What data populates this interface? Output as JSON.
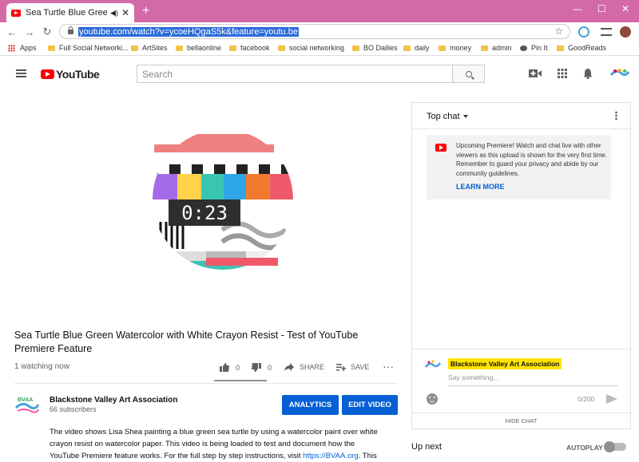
{
  "browser": {
    "tab_title": "Sea Turtle Blue Green Water",
    "url": "youtube.com/watch?v=ycoeHQgaS5k&feature=youtu.be",
    "bookmarks": [
      "Apps",
      "Full Social Networki...",
      "ArtSites",
      "bellaonline",
      "facebook",
      "social networking",
      "BO Dailies",
      "daily",
      "money",
      "admin",
      "Pin It",
      "GoodReads"
    ]
  },
  "youtube": {
    "logo_text": "YouTube",
    "search_placeholder": "Search"
  },
  "video": {
    "countdown": "0:23",
    "title": "Sea Turtle Blue Green Watercolor with White Crayon Resist - Test of YouTube Premiere Feature",
    "watching": "1 watching now",
    "likes": "0",
    "dislikes": "0",
    "share_label": "SHARE",
    "save_label": "SAVE"
  },
  "channel": {
    "name": "Blackstone Valley Art Association",
    "subscribers": "66 subscribers",
    "analytics_label": "ANALYTICS",
    "edit_label": "EDIT VIDEO"
  },
  "description": {
    "line1": "The video shows Lisa Shea painting a blue green sea turtle by using a watercolor paint over white",
    "line2": "crayon resist on watercolor paper. This video is being loaded to test and document how the",
    "line3_prefix": "YouTube Premiere feature works. For the full step by step instructions, visit ",
    "line3_link": "https://BVAA.org",
    "line3_suffix": ". This"
  },
  "chat": {
    "header": "Top chat",
    "premiere_text": "Upcoming Premiere! Watch and chat live with other viewers as this upload is shown for the very first time. Remember to guard your privacy and abide by our community guidelines.",
    "learn_more": "LEARN MORE",
    "author": "Blackstone Valley Art Association",
    "input_placeholder": "Say something...",
    "char_count": "0/200",
    "hide_chat": "HIDE CHAT"
  },
  "sidebar": {
    "up_next": "Up next",
    "autoplay": "AUTOPLAY"
  },
  "colors": {
    "chrome_frame": "#d36aa7",
    "accent_blue": "#065fd4",
    "youtube_red": "#ff0000",
    "chat_name_highlight": "#ffe500"
  }
}
